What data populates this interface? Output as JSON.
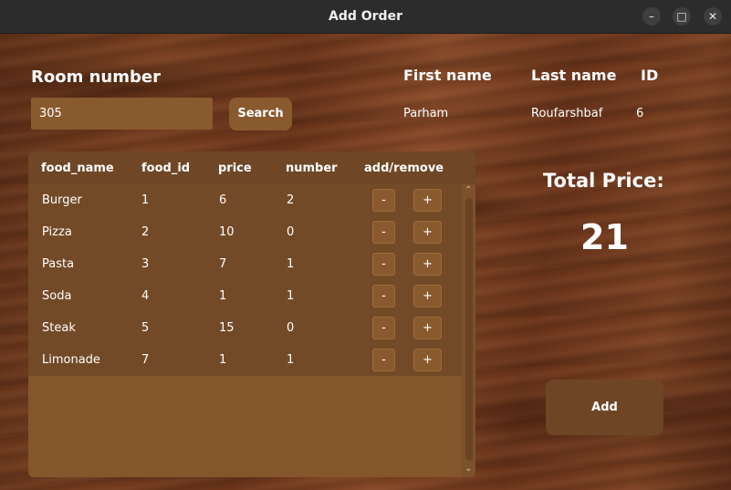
{
  "window": {
    "title": "Add Order"
  },
  "form": {
    "room_label": "Room number",
    "room_value": "305",
    "search_label": "Search"
  },
  "guest": {
    "first_name_label": "First name",
    "last_name_label": "Last name",
    "id_label": "ID",
    "first_name": "Parham",
    "last_name": "Roufarshbaf",
    "id": "6"
  },
  "table": {
    "columns": [
      "food_name",
      "food_id",
      "price",
      "number",
      "add/remove"
    ],
    "minus_label": "-",
    "plus_label": "+",
    "rows": [
      {
        "food_name": "Burger",
        "food_id": "1",
        "price": "6",
        "number": "2"
      },
      {
        "food_name": "Pizza",
        "food_id": "2",
        "price": "10",
        "number": "0"
      },
      {
        "food_name": "Pasta",
        "food_id": "3",
        "price": "7",
        "number": "1"
      },
      {
        "food_name": "Soda",
        "food_id": "4",
        "price": "1",
        "number": "1"
      },
      {
        "food_name": "Steak",
        "food_id": "5",
        "price": "15",
        "number": "0"
      },
      {
        "food_name": "Limonade",
        "food_id": "7",
        "price": "1",
        "number": "1"
      }
    ]
  },
  "summary": {
    "total_label": "Total Price:",
    "total_value": "21",
    "add_label": "Add"
  },
  "icons": {
    "minimize": "minimize-icon",
    "maximize": "maximize-icon",
    "close": "close-icon"
  }
}
